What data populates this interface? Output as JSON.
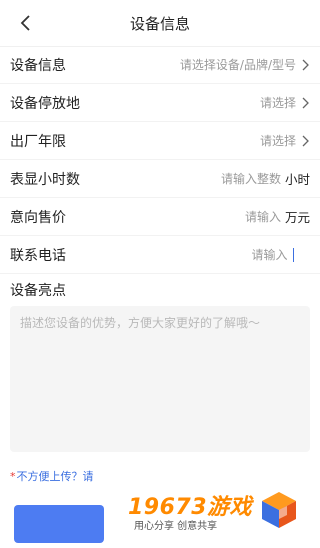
{
  "header": {
    "title": "设备信息"
  },
  "rows": [
    {
      "label": "设备信息",
      "value": "请选择设备/品牌/型号"
    },
    {
      "label": "设备停放地",
      "value": "请选择"
    },
    {
      "label": "出厂年限",
      "value": "请选择"
    },
    {
      "label": "表显小时数",
      "value": "请输入整数",
      "unit": "小时"
    },
    {
      "label": "意向售价",
      "value": "请输入",
      "unit": "万元"
    },
    {
      "label": "联系电话",
      "value": "请输入"
    }
  ],
  "highlights": {
    "label": "设备亮点",
    "placeholder": "描述您设备的优势，方便大家更好的了解哦～"
  },
  "notice": {
    "star": "*",
    "text": "不方便上传？请"
  },
  "watermark": {
    "brand": "19673游戏",
    "slogan": "用心分享 创意共享"
  },
  "colors": {
    "accent": "#4d7cf2",
    "brand_orange": "#ff8a00"
  }
}
